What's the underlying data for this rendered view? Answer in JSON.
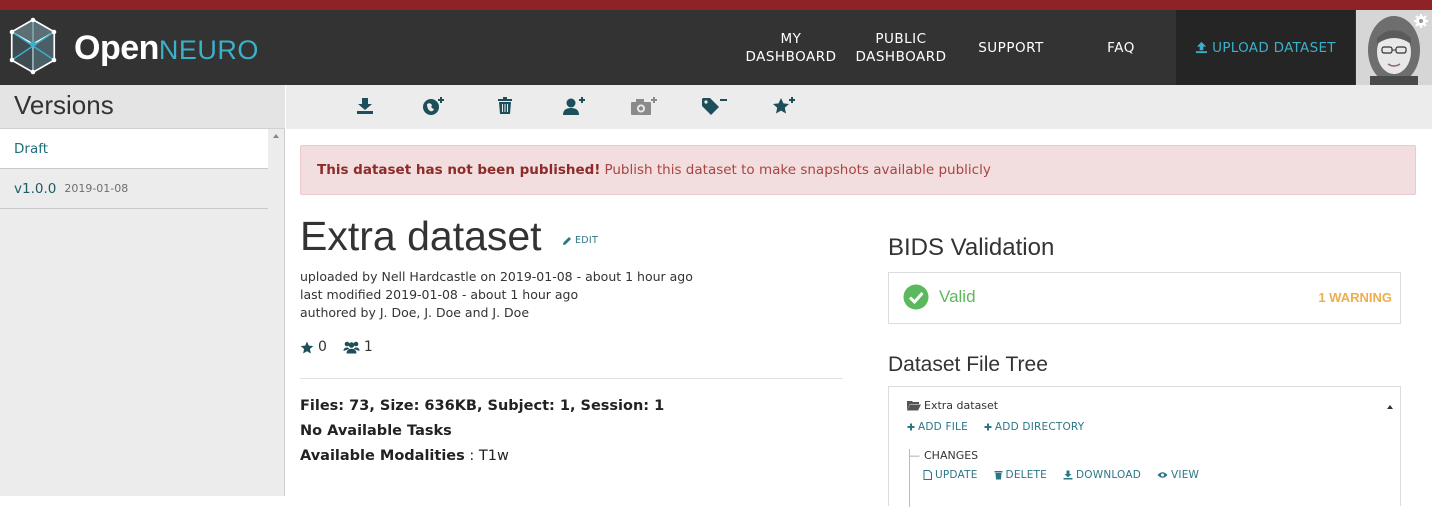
{
  "brand": {
    "part1": "Open",
    "part2": "NEURO"
  },
  "nav": {
    "my_dashboard": "MY\nDASHBOARD",
    "public_dashboard": "PUBLIC\nDASHBOARD",
    "support": "SUPPORT",
    "faq": "FAQ",
    "upload": "UPLOAD DATASET"
  },
  "sidebar": {
    "title": "Versions",
    "collapse_icon": "double-chevron-left-icon",
    "versions": [
      {
        "label": "Draft",
        "date": ""
      },
      {
        "label": "v1.0.0",
        "date": "2019-01-08"
      }
    ]
  },
  "toolbar": {
    "icons": [
      "download-icon",
      "globe-plus-icon",
      "trash-icon",
      "user-plus-icon",
      "camera-plus-icon",
      "tag-minus-icon",
      "star-plus-icon"
    ]
  },
  "alert": {
    "bold": "This dataset has not been published!",
    "text": "Publish this dataset to make snapshots available publicly"
  },
  "dataset": {
    "title": "Extra dataset",
    "edit_label": "EDIT",
    "uploaded": "uploaded by Nell Hardcastle on 2019-01-08 - about 1 hour ago",
    "modified": "last modified 2019-01-08 - about 1 hour ago",
    "authored": "authored by J. Doe, J. Doe and J. Doe",
    "stars": "0",
    "followers": "1",
    "files_summary": "Files: 73, Size: 636KB, Subject: 1, Session: 1",
    "tasks": "No Available Tasks",
    "modalities_label": "Available Modalities",
    "modalities_value": ": T1w"
  },
  "bids": {
    "title": "BIDS Validation",
    "status": "Valid",
    "warnings": "1 WARNING"
  },
  "tree": {
    "title": "Dataset File Tree",
    "root": "Extra dataset",
    "add_file": "ADD FILE",
    "add_directory": "ADD DIRECTORY",
    "item": "CHANGES",
    "actions": {
      "update": "UPDATE",
      "delete": "DELETE",
      "download": "DOWNLOAD",
      "view": "VIEW"
    }
  },
  "colors": {
    "accent": "#3ab0c9",
    "navbar": "#333333",
    "top_stripe": "#8f2225",
    "valid": "#5cb85c",
    "warning": "#f0ad4e",
    "alert_bg": "#f2dede"
  }
}
